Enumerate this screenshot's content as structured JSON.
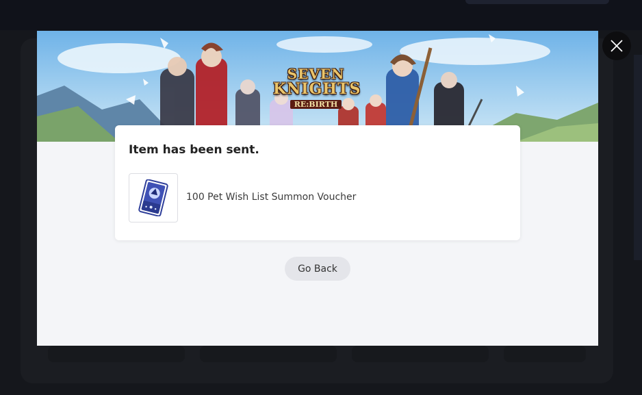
{
  "banner": {
    "logo_line1": "SEVEN",
    "logo_line2": "KNIGHTS",
    "logo_sub": "RE:BIRTH"
  },
  "dialog": {
    "title": "Item has been sent.",
    "item": {
      "name": "100 Pet Wish List Summon Voucher",
      "icon": "summon-voucher-card-icon"
    },
    "back_label": "Go Back"
  },
  "close_icon": "close-icon",
  "colors": {
    "overlay": "#14161b",
    "modal_bg": "#f4f5f8",
    "card_bg": "#ffffff",
    "button_bg": "#e4e5ea",
    "logo_gold": "#e9c46a",
    "voucher_blue": "#2f3f9a"
  }
}
